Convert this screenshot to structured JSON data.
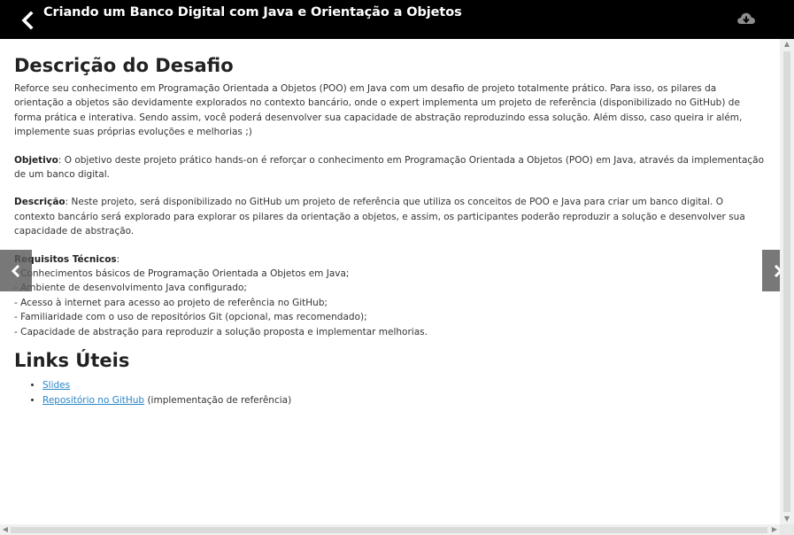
{
  "header": {
    "title": "Criando um Banco Digital com Java e Orientação a Objetos",
    "back_icon": "chevron-left-icon",
    "download_icon": "cloud-download-icon"
  },
  "content": {
    "heading_desc": "Descrição do Desafio",
    "intro": "Reforce seu conhecimento em Programação Orientada a Objetos (POO) em Java com um desafio de projeto totalmente prático. Para isso, os pilares da orientação a objetos são devidamente explorados no contexto bancário, onde o expert implementa um projeto de referência (disponibilizado no GitHub) de forma prática e interativa. Sendo assim, você poderá desenvolver sua capacidade de abstração reproduzindo essa solução. Além disso, caso queira ir além, implemente suas próprias evoluções e melhorias ;)",
    "objective_label": "Objetivo",
    "objective_text": ": O objetivo deste projeto prático hands-on é reforçar o conhecimento em Programação Orientada a Objetos (POO) em Java, através da implementação de um banco digital.",
    "description_label": "Descrição",
    "description_text": ": Neste projeto, será disponibilizado no GitHub um projeto de referência que utiliza os conceitos de POO e Java para criar um banco digital. O contexto bancário será explorado para explorar os pilares da orientação a objetos, e assim, os participantes poderão reproduzir a solução e desenvolver sua capacidade de abstração.",
    "requirements_label": "Requisitos Técnicos",
    "requirements_colon": ":",
    "requirements": [
      "- Conhecimentos básicos de Programação Orientada a Objetos em Java;",
      "- Ambiente de desenvolvimento Java configurado;",
      "- Acesso à internet para acesso ao projeto de referência no GitHub;",
      "- Familiaridade com o uso de repositórios Git (opcional, mas recomendado);",
      "- Capacidade de abstração para reproduzir a solução proposta e implementar melhorias."
    ],
    "heading_links": "Links Úteis",
    "links": [
      {
        "label": "Slides",
        "suffix": ""
      },
      {
        "label": "Repositório no GitHub",
        "suffix": " (implementação de referência)"
      }
    ]
  },
  "navigation": {
    "prev_icon": "chevron-left-icon",
    "next_icon": "chevron-right-icon"
  },
  "colors": {
    "header_bg": "#000000",
    "link": "#2a86c8",
    "nav_overlay": "#5a5a5a"
  }
}
